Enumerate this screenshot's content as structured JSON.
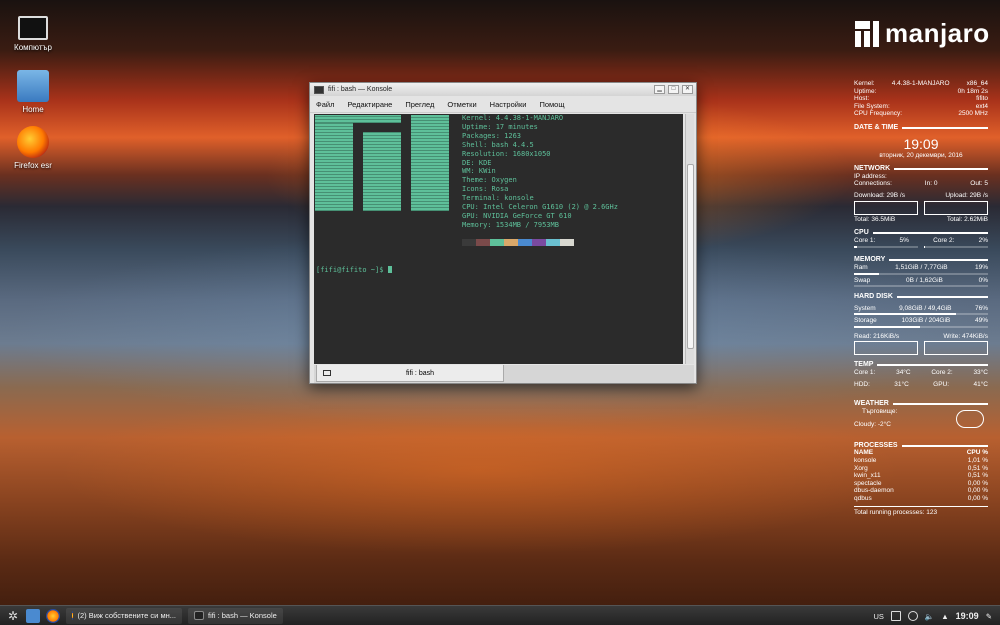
{
  "desktop": {
    "icons": [
      {
        "label": "Компютър",
        "icon": "computer-icon"
      },
      {
        "label": "Home",
        "icon": "home-folder-icon"
      },
      {
        "label": "Firefox esr",
        "icon": "firefox-icon"
      }
    ]
  },
  "branding": {
    "word": "manjaro"
  },
  "conky": {
    "system": [
      {
        "k": "Kernel:",
        "v": "4.4.38-1-MANJARO",
        "v2": "x86_64"
      },
      {
        "k": "Uptime:",
        "v": "",
        "v2": "0h 18m 2s"
      },
      {
        "k": "Host:",
        "v": "",
        "v2": "fifito"
      },
      {
        "k": "File System:",
        "v": "",
        "v2": "ext4"
      },
      {
        "k": "CPU Frequency:",
        "v": "",
        "v2": "2500 MHz"
      }
    ],
    "datetime": {
      "title": "DATE & TIME",
      "time": "19:09",
      "date": "вторник, 20 декември, 2016"
    },
    "network": {
      "title": "NETWORK",
      "ip_label": "IP address:",
      "conn_label": "Connections:",
      "in": "In: 0",
      "out": "Out: 5",
      "download": "Download: 29B  /s",
      "upload": "Upload: 29B  /s",
      "total_down": "Total: 36.5MiB",
      "total_up": "Total: 2.62MiB"
    },
    "cpu": {
      "title": "CPU",
      "core1_label": "Core 1:",
      "core1": "5%",
      "core2_label": "Core 2:",
      "core2": "2%",
      "core1_frac": 0.05,
      "core2_frac": 0.02
    },
    "memory": {
      "title": "MEMORY",
      "ram_label": "Ram",
      "ram": "1,51GiB / 7,77GiB",
      "ram_pct": "19%",
      "ram_frac": 0.19,
      "swap_label": "Swap",
      "swap": "0B  / 1,62GiB",
      "swap_pct": "0%",
      "swap_frac": 0.0
    },
    "disk": {
      "title": "HARD DISK",
      "sys_label": "System",
      "sys": "9,08GiB / 49,4GiB",
      "sys_pct": "76%",
      "sys_frac": 0.76,
      "sto_label": "Storage",
      "sto": "103GiB / 204GiB",
      "sto_pct": "49%",
      "sto_frac": 0.49,
      "read": "Read: 216KiB/s",
      "write": "Write: 474KiB/s"
    },
    "temp": {
      "title": "TEMP",
      "core1_label": "Core 1:",
      "core1": "34°C",
      "core2_label": "Core 2:",
      "core2": "33°C",
      "hdd_label": "HDD:",
      "hdd": "31°C",
      "gpu_label": "GPU:",
      "gpu": "41°C"
    },
    "weather": {
      "title": "WEATHER",
      "city": "Търговище:",
      "cond": "Cloudy: -2°C"
    },
    "processes": {
      "title": "PROCESSES",
      "col_name": "NAME",
      "col_cpu": "CPU %",
      "rows": [
        {
          "name": "konsole",
          "cpu": "1,01 %"
        },
        {
          "name": "Xorg",
          "cpu": "0,51 %"
        },
        {
          "name": "kwin_x11",
          "cpu": "0,51 %"
        },
        {
          "name": "spectacle",
          "cpu": "0,00 %"
        },
        {
          "name": "dbus-daemon",
          "cpu": "0,00 %"
        },
        {
          "name": "qdbus",
          "cpu": "0,00 %"
        }
      ],
      "total": "Total running processes: 123"
    }
  },
  "konsole": {
    "title": "fifi : bash — Konsole",
    "menu": [
      "Файл",
      "Редактиране",
      "Преглед",
      "Отметки",
      "Настройки",
      "Помощ"
    ],
    "info": [
      {
        "k": "Kernel: ",
        "v": "4.4.38-1-MANJARO"
      },
      {
        "k": "Uptime: ",
        "v": "17 minutes"
      },
      {
        "k": "Packages: ",
        "v": "1263"
      },
      {
        "k": "Shell: ",
        "v": "bash 4.4.5"
      },
      {
        "k": "Resolution: ",
        "v": "1680x1050"
      },
      {
        "k": "DE: ",
        "v": "KDE"
      },
      {
        "k": "WM: ",
        "v": "KWin"
      },
      {
        "k": "Theme: ",
        "v": "Oxygen"
      },
      {
        "k": "Icons: ",
        "v": "Rosa"
      },
      {
        "k": "Terminal: ",
        "v": "konsole"
      },
      {
        "k": "CPU: ",
        "v": "Intel Celeron G1610 (2) @ 2.6GHz"
      },
      {
        "k": "GPU: ",
        "v": "NVIDIA GeForce GT 610"
      },
      {
        "k": "Memory: ",
        "v": "1534MB / 7953MB"
      }
    ],
    "swatches": [
      "#3a3a3a",
      "#7a4a4a",
      "#5ec09a",
      "#d9a86a",
      "#4a8ad0",
      "#7a4aa0",
      "#6ac0d0",
      "#d8d8d0"
    ],
    "prompt": "[fifi@fifito ~]$ ",
    "tab_label": "fifi : bash"
  },
  "panel": {
    "tasks": [
      {
        "label": "(2) Виж собствените си мн...",
        "icon": "firefox-icon"
      },
      {
        "label": "fifi : bash — Konsole",
        "icon": "terminal-icon"
      }
    ],
    "layout": "US",
    "clock": "19:09"
  }
}
